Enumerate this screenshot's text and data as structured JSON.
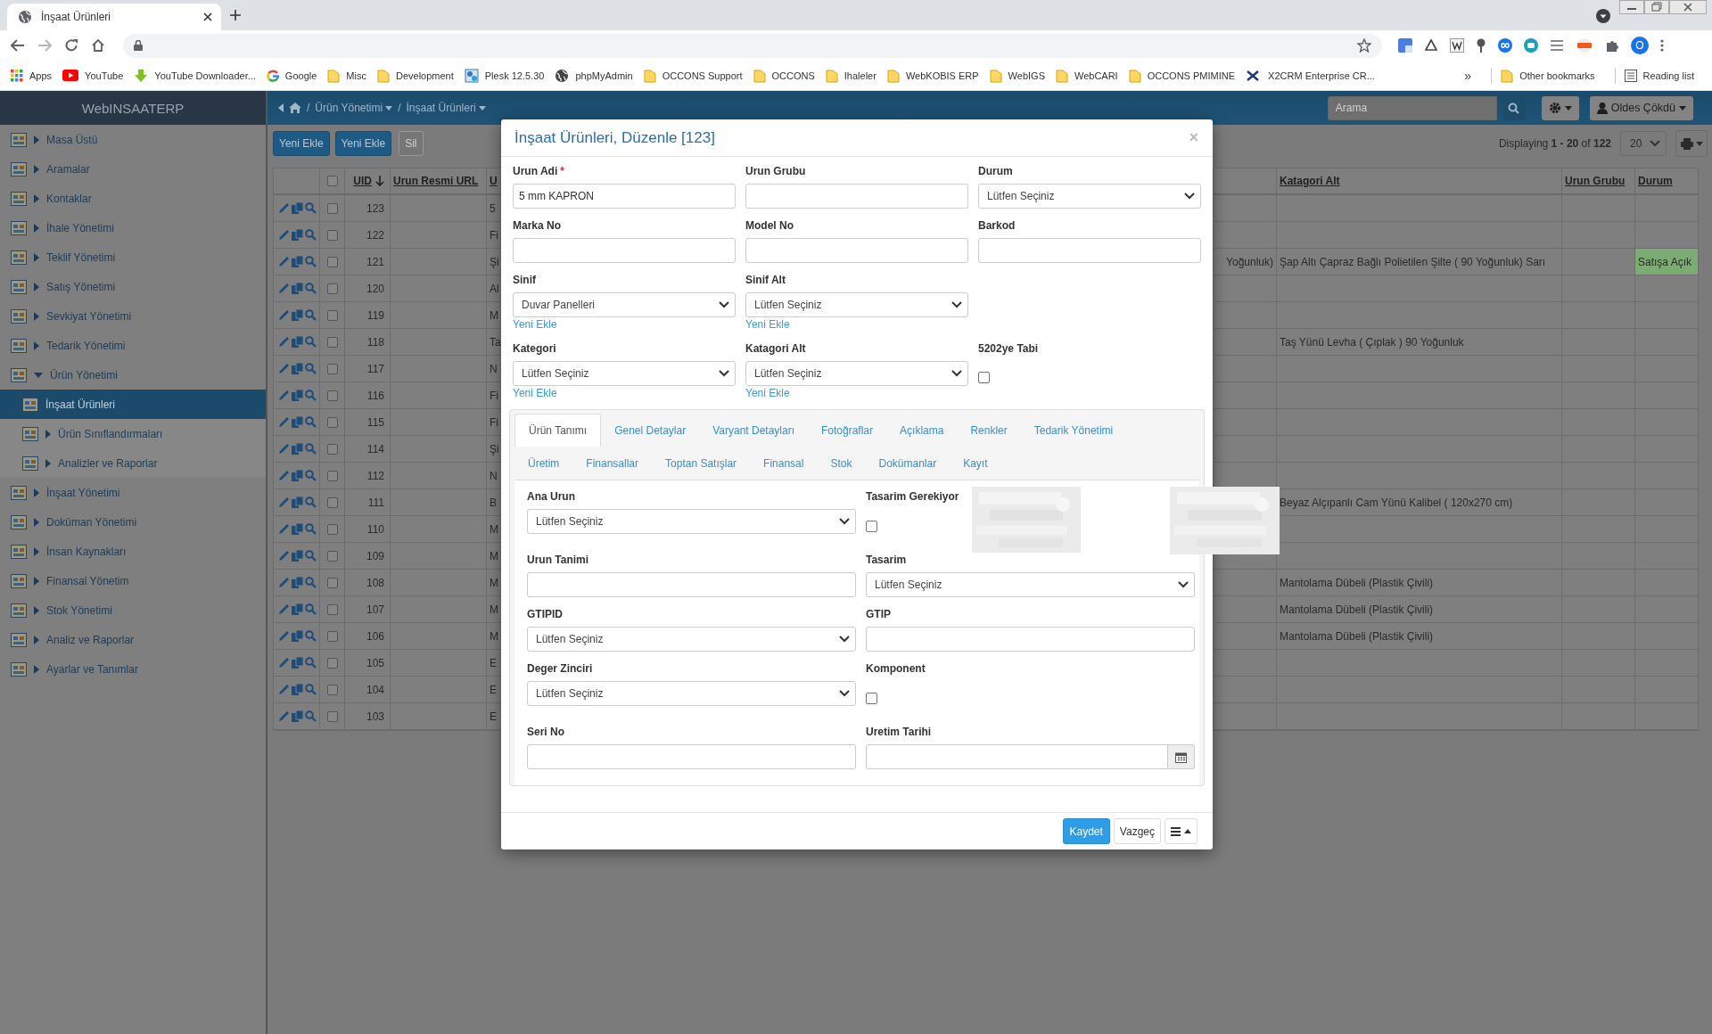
{
  "browser": {
    "tab_title": "İnşaat Ürünleri",
    "profile_initial": "O",
    "bookmarks": [
      {
        "label": "Apps",
        "kind": "apps"
      },
      {
        "label": "YouTube",
        "kind": "video"
      },
      {
        "label": "YouTube Downloader...",
        "kind": "download"
      },
      {
        "label": "Google",
        "kind": "ring"
      },
      {
        "label": "Misc",
        "kind": "folder"
      },
      {
        "label": "Development",
        "kind": "folder"
      },
      {
        "label": "Plesk 12.5.30",
        "kind": "gears"
      },
      {
        "label": "phpMyAdmin",
        "kind": "globe"
      },
      {
        "label": "OCCONS Support",
        "kind": "folder"
      },
      {
        "label": "OCCONS",
        "kind": "folder"
      },
      {
        "label": "Ihaleler",
        "kind": "folder"
      },
      {
        "label": "WebKOBIS ERP",
        "kind": "folder"
      },
      {
        "label": "WebIGS",
        "kind": "folder"
      },
      {
        "label": "WebCARI",
        "kind": "folder"
      },
      {
        "label": "OCCONS PMIMINE",
        "kind": "folder"
      },
      {
        "label": "X2CRM Enterprise CR...",
        "kind": "cross"
      }
    ],
    "overflow": "»",
    "other_bookmarks": "Other bookmarks",
    "reading_list": "Reading list"
  },
  "app": {
    "brand": "WebINSAATERP",
    "breadcrumb": [
      "Ürün Yönetimi",
      "İnşaat Ürünleri"
    ],
    "separator": "/",
    "search": {
      "placeholder": "Arama"
    },
    "user": "Oldes Çökdü"
  },
  "sidebar": {
    "items": [
      {
        "label": "Masa Üstü",
        "expanded": false,
        "selected": false
      },
      {
        "label": "Aramalar",
        "expanded": false,
        "selected": false
      },
      {
        "label": "Kontaklar",
        "expanded": false,
        "selected": false
      },
      {
        "label": "İhale Yönetimi",
        "expanded": false,
        "selected": false
      },
      {
        "label": "Teklif Yönetimi",
        "expanded": false,
        "selected": false
      },
      {
        "label": "Satış Yönetimi",
        "expanded": false,
        "selected": false
      },
      {
        "label": "Sevkiyat Yönetimi",
        "expanded": false,
        "selected": false
      },
      {
        "label": "Tedarik Yönetimi",
        "expanded": false,
        "selected": false
      },
      {
        "label": "Ürün Yönetimi",
        "expanded": true,
        "selected": false,
        "children": [
          {
            "label": "İnşaat Ürünleri",
            "selected": true
          },
          {
            "label": "Ürün Sınıflandırmaları",
            "expanded": false,
            "selected": false
          },
          {
            "label": "Analizler ve Raporlar",
            "expanded": false,
            "selected": false
          }
        ]
      },
      {
        "label": "İnşaat Yönetimi",
        "expanded": false,
        "selected": false
      },
      {
        "label": "Doküman Yönetimi",
        "expanded": false,
        "selected": false
      },
      {
        "label": "İnsan Kaynakları",
        "expanded": false,
        "selected": false
      },
      {
        "label": "Finansal Yönetim",
        "expanded": false,
        "selected": false
      },
      {
        "label": "Stok Yönetimi",
        "expanded": false,
        "selected": false
      },
      {
        "label": "Analiz ve Raporlar",
        "expanded": false,
        "selected": false
      },
      {
        "label": "Ayarlar ve Tanımlar",
        "expanded": false,
        "selected": false
      }
    ]
  },
  "toolbar": {
    "buttons": [
      {
        "label": "Yeni Ekle",
        "disabled": false
      },
      {
        "label": "Yeni Ekle",
        "disabled": false
      },
      {
        "label": "Sil",
        "disabled": true
      }
    ],
    "paging": "Displaying **1 - 20** of **122**",
    "page_size": "20"
  },
  "table": {
    "select_all": {
      "checked": false
    },
    "columns": [
      {
        "label": "UID",
        "sorted": true
      },
      {
        "label": "Urun Resmi URL",
        "sorted": false
      },
      {
        "label": "U"
      },
      {},
      {
        "label": "Katagori Alt",
        "sorted": false
      },
      {
        "label": "Urun Grubu",
        "sorted": false
      },
      {
        "label": "Durum",
        "sorted": false
      }
    ],
    "rows": [
      {
        "checked": false,
        "uid": "123",
        "column_5": "5"
      },
      {
        "checked": false,
        "uid": "122",
        "column_5": "Fi"
      },
      {
        "checked": false,
        "uid": "121",
        "column_5": "Şi",
        "column_6": "Yoğunluk)",
        "katagori_alt": "Şap Altı Çapraz Bağlı Polietilen Şilte ( 90 Yoğunluk) Sarı",
        "durum": "Satışa Açık",
        "color": "#7cab74"
      },
      {
        "checked": false,
        "uid": "120",
        "column_5": "Al"
      },
      {
        "checked": false,
        "uid": "119",
        "column_5": "M"
      },
      {
        "checked": false,
        "uid": "118",
        "column_5": "Ta",
        "katagori_alt": "Taş Yünü Levha ( Çıplak ) 90 Yoğunluk"
      },
      {
        "checked": false,
        "uid": "117",
        "column_5": "N"
      },
      {
        "checked": false,
        "uid": "116",
        "column_5": "Fi"
      },
      {
        "checked": false,
        "uid": "115",
        "column_5": "Fi"
      },
      {
        "checked": false,
        "uid": "114",
        "column_5": "Şi"
      },
      {
        "checked": false,
        "uid": "112",
        "column_5": "N"
      },
      {
        "checked": false,
        "uid": "111",
        "column_5": "B",
        "katagori_alt": "Beyaz Alçıpanlı Cam Yünü Kalibel ( 120x270 cm)"
      },
      {
        "checked": false,
        "uid": "110",
        "column_5": "M"
      },
      {
        "checked": false,
        "uid": "109",
        "column_5": "M"
      },
      {
        "checked": false,
        "uid": "108",
        "column_5": "M",
        "katagori_alt": "Mantolama Dübeli (Plastik Çivili)"
      },
      {
        "checked": false,
        "uid": "107",
        "column_5": "M",
        "katagori_alt": "Mantolama Dübeli (Plastik Çivili)"
      },
      {
        "checked": false,
        "uid": "106",
        "column_5": "M",
        "katagori_alt": "Mantolama Dübeli (Plastik Çivili)"
      },
      {
        "checked": false,
        "uid": "105",
        "column_5": "E"
      },
      {
        "checked": false,
        "uid": "104",
        "column_5": "E"
      },
      {
        "checked": false,
        "uid": "103",
        "column_5": "E"
      }
    ]
  },
  "modal": {
    "title": "İnşaat Ürünleri, Düzenle [123]",
    "close": "×",
    "rows": [
      [
        {
          "label": "Urun Adi",
          "marker": "*",
          "kind": "text",
          "value": "5 mm KAPRON"
        },
        {
          "label": "Urun Grubu",
          "kind": "text"
        },
        {
          "label": "Durum",
          "kind": "select",
          "value": "Lütfen Seçiniz"
        }
      ],
      [
        {
          "label": "Marka No",
          "kind": "text"
        },
        {
          "label": "Model No",
          "kind": "text"
        },
        {
          "label": "Barkod",
          "kind": "text"
        }
      ],
      [
        {
          "label": "Sinif",
          "kind": "select",
          "value": "Duvar Panelleri",
          "link": "Yeni Ekle"
        },
        {
          "label": "Sinif Alt",
          "kind": "select",
          "value": "Lütfen Seçiniz",
          "link": "Yeni Ekle"
        }
      ],
      [
        {
          "label": "Kategori",
          "kind": "select",
          "value": "Lütfen Seçiniz",
          "link": "Yeni Ekle"
        },
        {
          "label": "Katagori Alt",
          "kind": "select",
          "value": "Lütfen Seçiniz",
          "link": "Yeni Ekle"
        },
        {
          "label": "5202ye Tabi",
          "kind": "checkbox",
          "checked": false
        }
      ]
    ],
    "tab_rows": [
      [
        {
          "label": "Ürün Tanımı",
          "selected": true
        },
        {
          "label": "Genel Detaylar",
          "selected": false
        },
        {
          "label": "Varyant Detayları",
          "selected": false
        },
        {
          "label": "Fotoğraflar",
          "selected": false
        },
        {
          "label": "Açıklama",
          "selected": false
        },
        {
          "label": "Renkler",
          "selected": false
        },
        {
          "label": "Tedarik Yönetimi",
          "selected": false
        }
      ],
      [
        {
          "label": "Üretim",
          "selected": false
        },
        {
          "label": "Finansallar",
          "selected": false
        },
        {
          "label": "Toptan Satışlar",
          "selected": false
        },
        {
          "label": "Finansal",
          "selected": false
        },
        {
          "label": "Stok",
          "selected": false
        },
        {
          "label": "Dokümanlar",
          "selected": false
        },
        {
          "label": "Kayıt",
          "selected": false
        }
      ]
    ],
    "tab_content": [
      [
        {
          "label": "Ana Urun",
          "kind": "select",
          "value": "Lütfen Seçiniz"
        },
        {
          "label": "Tasarim Gerekiyor",
          "kind": "checkbox",
          "checked": false
        }
      ],
      [
        {
          "label": "Urun Tanimi",
          "kind": "text"
        },
        {
          "label": "Tasarim",
          "kind": "select",
          "value": "Lütfen Seçiniz"
        }
      ],
      [
        {
          "label": "GTIPID",
          "kind": "select",
          "value": "Lütfen Seçiniz"
        },
        {
          "label": "GTIP",
          "kind": "text"
        }
      ],
      [
        {
          "label": "Deger Zinciri",
          "kind": "select",
          "value": "Lütfen Seçiniz"
        },
        {
          "label": "Komponent",
          "kind": "checkbox",
          "checked": false
        }
      ],
      [
        {
          "label": "Seri No",
          "kind": "text"
        },
        {
          "label": "Uretim Tarihi",
          "kind": "date"
        }
      ]
    ],
    "buttons": [
      {
        "label": "Kaydet",
        "kind": "primary"
      },
      {
        "label": "Vazgeç",
        "kind": "default"
      },
      {
        "kind": "menu"
      }
    ]
  }
}
